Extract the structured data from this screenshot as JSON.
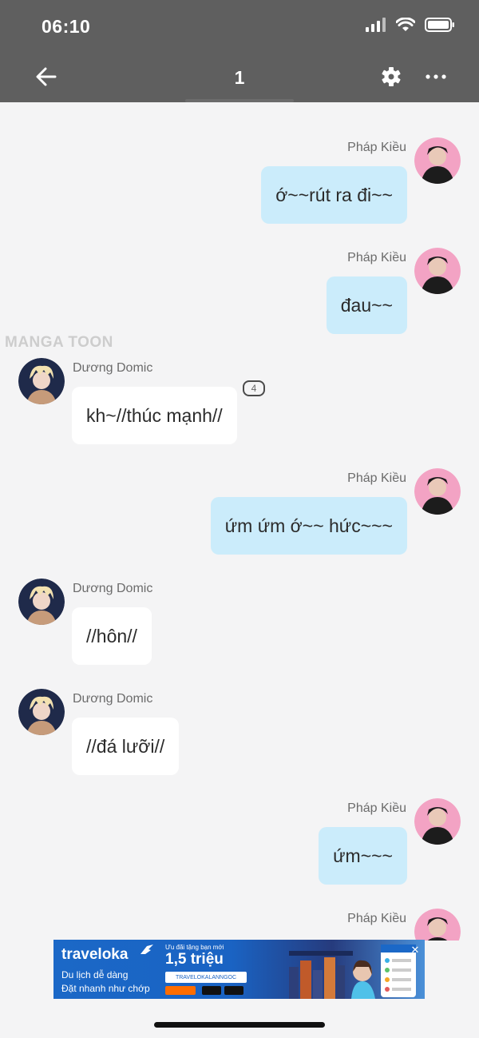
{
  "status_bar": {
    "time": "06:10"
  },
  "header": {
    "title": "1"
  },
  "watermark": "MANGA TOON",
  "messages": [
    {
      "sender": "Pháp Kiều",
      "text": "ớ~~rút ra đi~~",
      "side": "right"
    },
    {
      "sender": "Pháp Kiều",
      "text": "đau~~",
      "side": "right"
    },
    {
      "sender": "Dương Domic",
      "text": "kh~//thúc mạnh//",
      "side": "left",
      "badge": "4"
    },
    {
      "sender": "Pháp Kiều",
      "text": "ứm ứm ớ~~ hức~~~",
      "side": "right"
    },
    {
      "sender": "Dương Domic",
      "text": "//hôn//",
      "side": "left"
    },
    {
      "sender": "Dương Domic",
      "text": "//đá lưỡi//",
      "side": "left"
    },
    {
      "sender": "Pháp Kiều",
      "text": "ứm~~~",
      "side": "right"
    },
    {
      "sender": "Pháp Kiều",
      "text": "",
      "side": "right"
    }
  ],
  "ad": {
    "brand": "traveloka",
    "line1": "Du lịch dễ dàng",
    "line2": "Đặt nhanh như chớp",
    "promo_small": "Ưu đãi tặng bạn mới",
    "promo_big": "1,5 triệu",
    "code": "TRAVELOKALANNGOC"
  },
  "colors": {
    "header_bg": "#5f5f5f",
    "page_bg": "#f4f4f5",
    "own_bubble": "#cbecfb",
    "other_bubble": "#ffffff"
  }
}
